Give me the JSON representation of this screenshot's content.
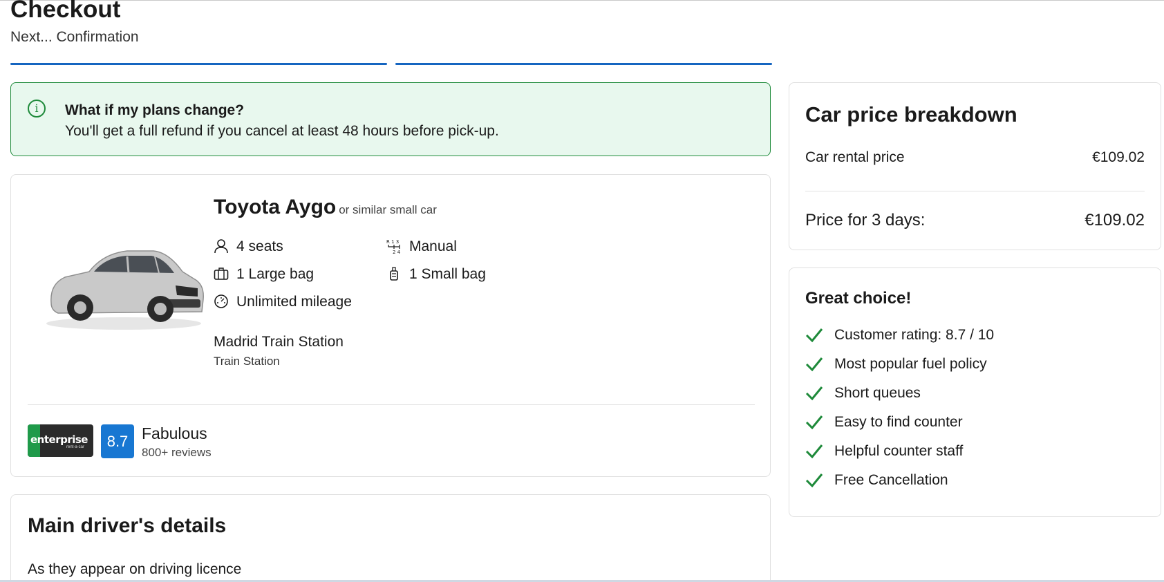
{
  "header": {
    "title": "Checkout",
    "subtitle": "Next... Confirmation"
  },
  "notice": {
    "icon": "info-icon",
    "title": "What if my plans change?",
    "text": "You'll get a full refund if you cancel at least 48 hours before pick-up."
  },
  "car": {
    "name": "Toyota Aygo",
    "similar": "or similar small car",
    "specs": {
      "seats": "4 seats",
      "transmission": "Manual",
      "large_bag": "1 Large bag",
      "small_bag": "1 Small bag",
      "mileage": "Unlimited mileage"
    },
    "location": "Madrid Train Station",
    "location_type": "Train Station",
    "supplier": {
      "logo_text": "enterprise",
      "logo_tag": "rent-a-car",
      "score": "8.7",
      "rating_label": "Fabulous",
      "reviews": "800+ reviews"
    }
  },
  "driver": {
    "title": "Main driver's details",
    "subtitle": "As they appear on driving licence"
  },
  "price": {
    "title": "Car price breakdown",
    "rental_label": "Car rental price",
    "rental_value": "€109.02",
    "total_label": "Price for 3 days:",
    "total_value": "€109.02"
  },
  "choice": {
    "title": "Great choice!",
    "items": [
      "Customer rating: 8.7 / 10",
      "Most popular fuel policy",
      "Short queues",
      "Easy to find counter",
      "Helpful counter staff",
      "Free Cancellation"
    ]
  },
  "colors": {
    "accent": "#1565c0",
    "success": "#1e8a3a",
    "banner_bg": "#e8f8ee",
    "rating_badge": "#1877d2"
  }
}
